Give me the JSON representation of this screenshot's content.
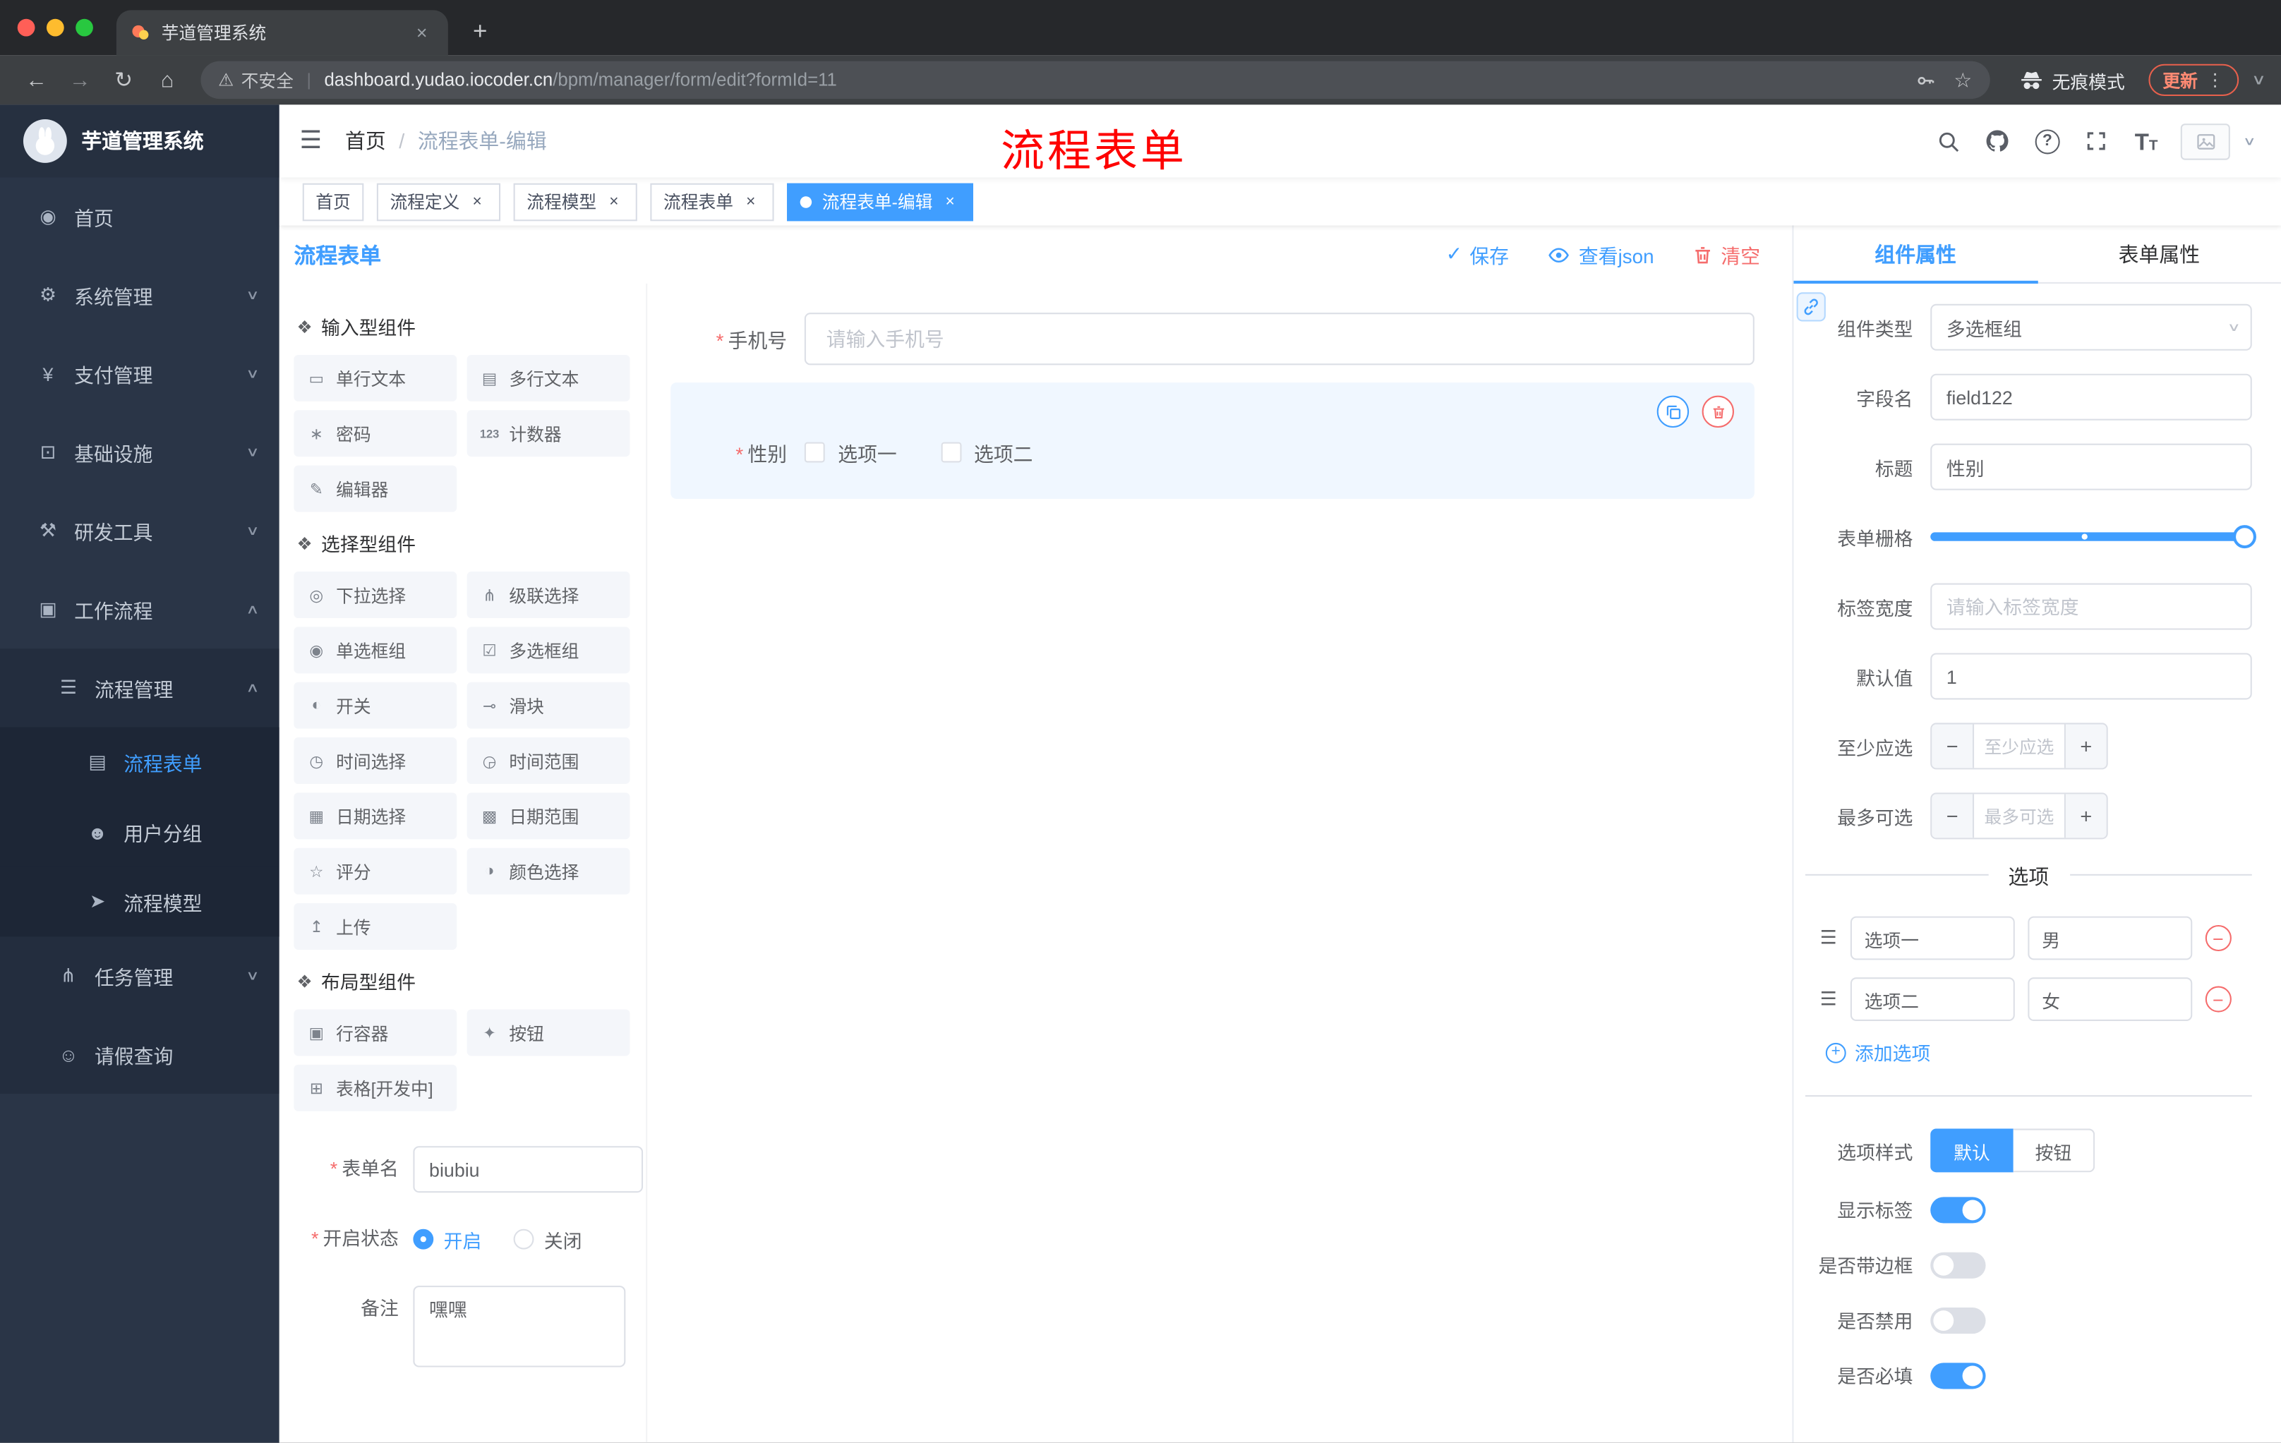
{
  "browser": {
    "tab_title": "芋道管理系统",
    "security_label": "不安全",
    "url_host": "dashboard.yudao.iocoder.cn",
    "url_path": "/bpm/manager/form/edit?formId=11",
    "incognito_label": "无痕模式",
    "update_label": "更新"
  },
  "glyphs": {
    "back": "←",
    "forward": "→",
    "reload": "↻",
    "home": "⌂",
    "warning": "⚠",
    "divider": "|",
    "star": "☆",
    "new_tab": "+",
    "close": "×",
    "kebab": "⋮",
    "chevron_down": "∨",
    "chevron_up": "∧",
    "check": "✓",
    "help": "?",
    "font_T_big": "T",
    "font_T_small": "T",
    "hamburger": "☰",
    "caret": "▾",
    "minus": "−",
    "plus": "+",
    "handle": "☰",
    "breadcrumb_sep": "/",
    "group_icon": "❖",
    "av_caret": "∨"
  },
  "sidebar": {
    "logo_title": "芋道管理系统",
    "menu": [
      {
        "label": "首页",
        "icon": "◉"
      },
      {
        "label": "系统管理",
        "icon": "⚙"
      },
      {
        "label": "支付管理",
        "icon": "¥"
      },
      {
        "label": "基础设施",
        "icon": "⊡"
      },
      {
        "label": "研发工具",
        "icon": "⚒"
      },
      {
        "label": "工作流程",
        "icon": "▣"
      },
      {
        "label": "流程管理",
        "icon": "☰"
      },
      {
        "label": "流程表单",
        "icon": "▤"
      },
      {
        "label": "用户分组",
        "icon": "☻"
      },
      {
        "label": "流程模型",
        "icon": "➤"
      },
      {
        "label": "任务管理",
        "icon": "⋔"
      },
      {
        "label": "请假查询",
        "icon": "☺"
      }
    ]
  },
  "header": {
    "breadcrumb_home": "首页",
    "breadcrumb_current": "流程表单-编辑",
    "annotation": "流程表单"
  },
  "tags": [
    {
      "label": "首页"
    },
    {
      "label": "流程定义"
    },
    {
      "label": "流程模型"
    },
    {
      "label": "流程表单"
    },
    {
      "label": "流程表单-编辑"
    }
  ],
  "designer": {
    "title": "流程表单",
    "save_label": "保存",
    "view_json_label": "查看json",
    "clear_label": "清空",
    "groups": [
      {
        "title": "输入型组件",
        "items": [
          {
            "label": "单行文本",
            "icon": "▭"
          },
          {
            "label": "多行文本",
            "icon": "▤"
          },
          {
            "label": "密码",
            "icon": "∗"
          },
          {
            "label": "计数器",
            "icon": "123"
          },
          {
            "label": "编辑器",
            "icon": "✎"
          }
        ]
      },
      {
        "title": "选择型组件",
        "items": [
          {
            "label": "下拉选择",
            "icon": "◎"
          },
          {
            "label": "级联选择",
            "icon": "⋔"
          },
          {
            "label": "单选框组",
            "icon": "◉"
          },
          {
            "label": "多选框组",
            "icon": "☑"
          },
          {
            "label": "开关",
            "icon": "◐"
          },
          {
            "label": "滑块",
            "icon": "⊸"
          },
          {
            "label": "时间选择",
            "icon": "◷"
          },
          {
            "label": "时间范围",
            "icon": "◶"
          },
          {
            "label": "日期选择",
            "icon": "▦"
          },
          {
            "label": "日期范围",
            "icon": "▩"
          },
          {
            "label": "评分",
            "icon": "☆"
          },
          {
            "label": "颜色选择",
            "icon": "◑"
          },
          {
            "label": "上传",
            "icon": "↥"
          }
        ]
      },
      {
        "title": "布局型组件",
        "items": [
          {
            "label": "行容器",
            "icon": "▣"
          },
          {
            "label": "按钮",
            "icon": "✦"
          },
          {
            "label": "表格[开发中]",
            "icon": "⊞"
          }
        ]
      }
    ],
    "meta": {
      "form_name_label": "表单名",
      "form_name_value": "biubiu",
      "status_label": "开启状态",
      "status_on": "开启",
      "status_off": "关闭",
      "remark_label": "备注",
      "remark_value": "嘿嘿"
    },
    "canvas": {
      "phone_label": "手机号",
      "phone_placeholder": "请输入手机号",
      "gender_label": "性别",
      "gender_option1": "选项一",
      "gender_option2": "选项二"
    }
  },
  "props": {
    "tab_component": "组件属性",
    "tab_form": "表单属性",
    "component_type_label": "组件类型",
    "component_type_value": "多选框组",
    "field_name_label": "字段名",
    "field_name_value": "field122",
    "title_label": "标题",
    "title_value": "性别",
    "grid_label": "表单栅格",
    "label_width_label": "标签宽度",
    "label_width_placeholder": "请输入标签宽度",
    "default_label": "默认值",
    "default_value": "1",
    "min_label": "至少应选",
    "min_placeholder": "至少应选",
    "max_label": "最多可选",
    "max_placeholder": "最多可选",
    "options_title": "选项",
    "options": [
      {
        "label": "选项一",
        "value": "男"
      },
      {
        "label": "选项二",
        "value": "女"
      }
    ],
    "add_option_label": "添加选项",
    "option_style_label": "选项样式",
    "style_default": "默认",
    "style_button": "按钮",
    "switches": [
      {
        "label": "显示标签",
        "on": true
      },
      {
        "label": "是否带边框",
        "on": false
      },
      {
        "label": "是否禁用",
        "on": false
      },
      {
        "label": "是否必填",
        "on": true
      }
    ]
  },
  "colors": {
    "accent": "#409eff",
    "danger": "#f56c6c",
    "annotation_red": "#fe0100",
    "sidebar_bg": "#2a3547"
  }
}
